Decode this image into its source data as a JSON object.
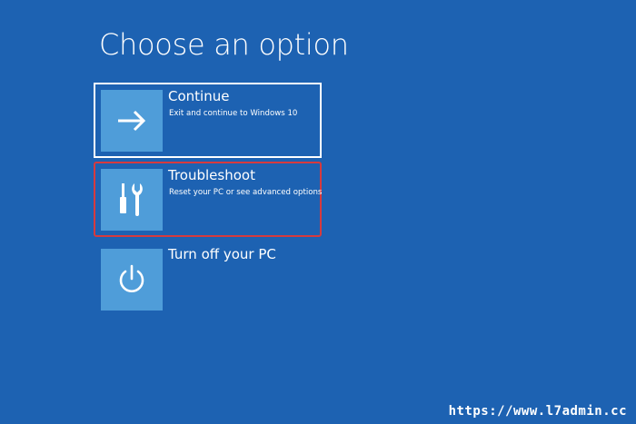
{
  "page": {
    "title": "Choose an option"
  },
  "options": [
    {
      "label": "Continue",
      "description": "Exit and continue to Windows 10",
      "icon": "arrow-right-icon"
    },
    {
      "label": "Troubleshoot",
      "description": "Reset your PC or see advanced options",
      "icon": "tools-icon"
    },
    {
      "label": "Turn off your PC",
      "description": "",
      "icon": "power-icon"
    }
  ],
  "watermark": {
    "text": "https://www.l7admin.cc"
  },
  "colors": {
    "background": "#1d62b2",
    "tile": "#4f9dd9",
    "highlight_border": "#d63a3e",
    "text": "#ffffff"
  }
}
